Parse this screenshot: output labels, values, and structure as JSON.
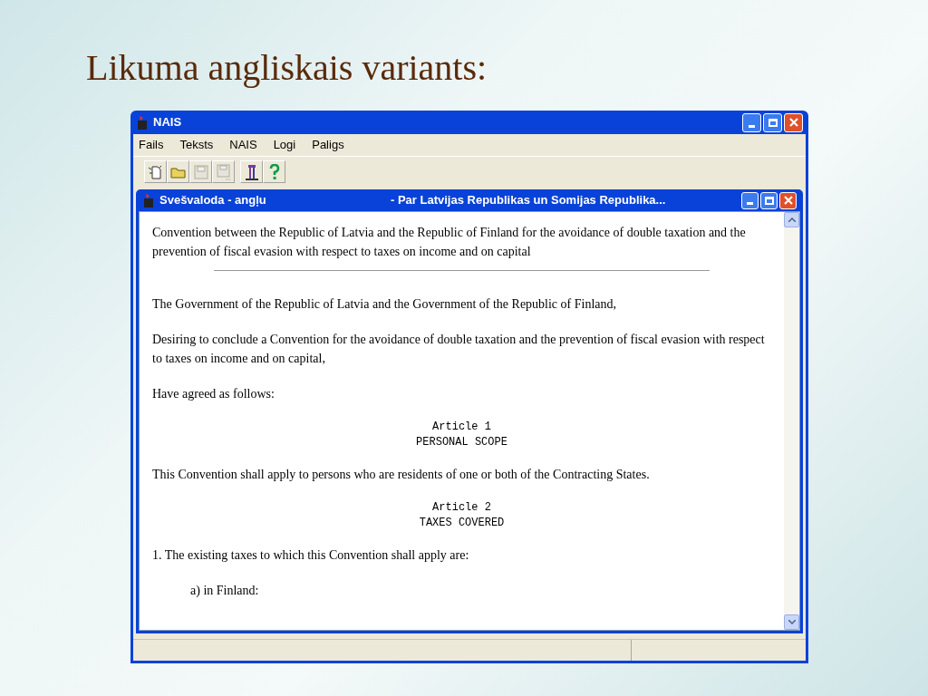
{
  "slide": {
    "title": "Likuma angliskais variants:"
  },
  "window": {
    "title": "NAIS"
  },
  "menu": [
    "Fails",
    "Teksts",
    "NAIS",
    "Logi",
    "Paligs"
  ],
  "toolbar": [
    {
      "kind": "new",
      "disabled": false
    },
    {
      "kind": "open",
      "disabled": false
    },
    {
      "kind": "save",
      "disabled": true
    },
    {
      "kind": "save-as",
      "disabled": true
    },
    {
      "kind": "separator"
    },
    {
      "kind": "tool",
      "disabled": false
    },
    {
      "kind": "help",
      "disabled": false
    }
  ],
  "child_window": {
    "title": "Svešvaloda - angļu",
    "subtitle": "- Par Latvijas Republikas un Somijas Republika..."
  },
  "document": [
    {
      "kind": "paragraph",
      "text": "Convention between the Republic of Latvia and the Republic of Finland for the avoidance of double taxation and the prevention of fiscal evasion with respect to taxes on income and on capital"
    },
    {
      "kind": "rule"
    },
    {
      "kind": "paragraph",
      "text": "The Government of the Republic of Latvia and the Government of the Republic of Finland,"
    },
    {
      "kind": "paragraph",
      "text": "Desiring to conclude a Convention for the avoidance of double taxation and the prevention of fiscal evasion with respect to taxes on income and on capital,"
    },
    {
      "kind": "paragraph",
      "text": "Have agreed as follows:"
    },
    {
      "kind": "heading",
      "lines": [
        "Article 1",
        "PERSONAL SCOPE"
      ]
    },
    {
      "kind": "paragraph",
      "text": "This Convention shall apply to persons who are residents of one or both of the Contracting States."
    },
    {
      "kind": "heading",
      "lines": [
        "Article 2",
        "TAXES COVERED"
      ]
    },
    {
      "kind": "paragraph",
      "text": "1. The existing taxes to which this Convention shall apply are:"
    },
    {
      "kind": "indented",
      "text": "a) in Finland:"
    }
  ]
}
